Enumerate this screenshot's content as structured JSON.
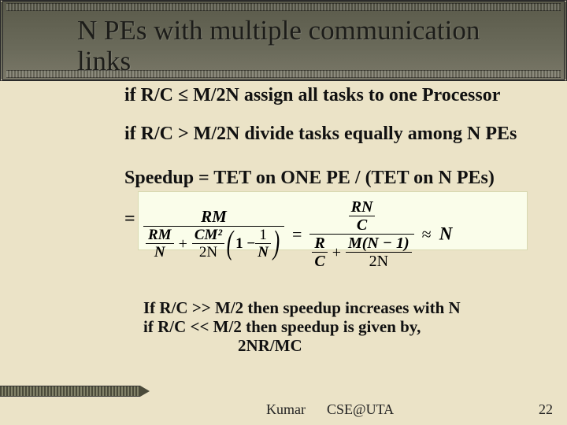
{
  "title": "N PEs with multiple communication links",
  "body": {
    "cond1": "if R/C ≤ M/2N assign all tasks to one Processor",
    "cond2": "if R/C > M/2N divide tasks equally among N PEs",
    "speedup_def": "Speedup = TET on ONE PE / (TET on N PEs)",
    "eq_lead": "=",
    "concl1": "If R/C >> M/2 then speedup increases with N",
    "concl2": "if R/C << M/2 then speedup is given by,",
    "concl3": "2NR/MC"
  },
  "formula": {
    "lhs_num": "RM",
    "lhs_den_t1_num": "RM",
    "lhs_den_t1_den": "N",
    "lhs_den_t2_num": "CM²",
    "lhs_den_t2_den": "2N",
    "lhs_den_inner_lead": "1 −",
    "lhs_den_inner_frac_num": "1",
    "lhs_den_inner_frac_den": "N",
    "eq": "=",
    "rhs1_num_num": "RN",
    "rhs1_num_den": "C",
    "rhs1_den_t1_num": "R",
    "rhs1_den_t1_den": "C",
    "rhs1_den_plus": "+",
    "rhs1_den_t2_num": "M(N − 1)",
    "rhs1_den_t2_den": "2N",
    "approx": "≈",
    "rhs2": "N"
  },
  "footer": {
    "author": "Kumar",
    "course": "CSE@UTA",
    "page": "22"
  }
}
